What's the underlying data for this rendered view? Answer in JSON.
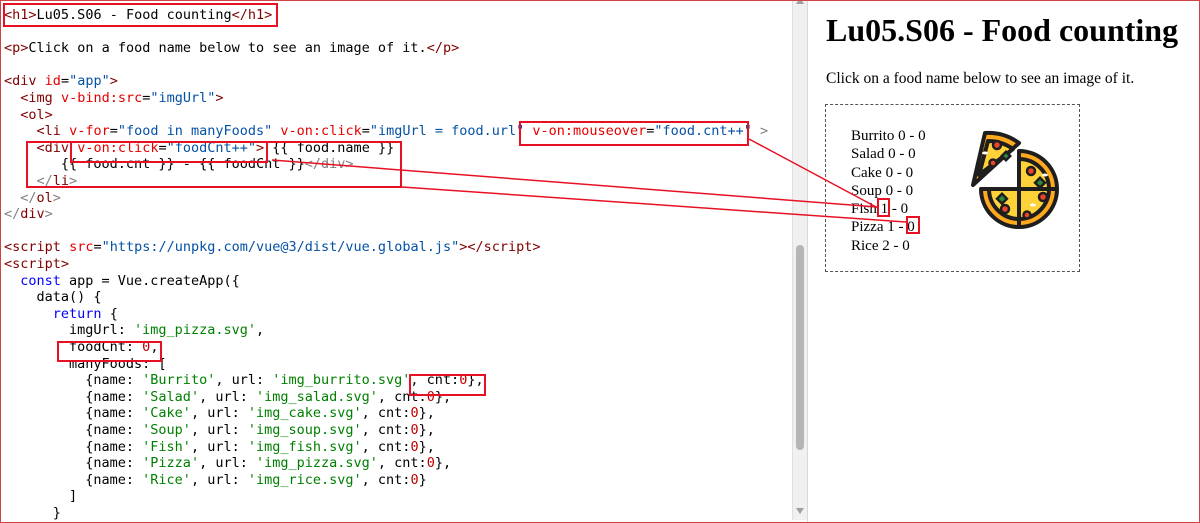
{
  "editor": {
    "lines": [
      {
        "parts": [
          [
            "tag",
            "<"
          ],
          [
            "tagname",
            "h1"
          ],
          [
            "tag",
            ">"
          ],
          [
            "punct",
            "Lu05.S06 - Food counting"
          ],
          [
            "tag",
            "</"
          ],
          [
            "tagname",
            "h1"
          ],
          [
            "tag",
            ">"
          ]
        ]
      },
      {
        "parts": []
      },
      {
        "parts": [
          [
            "tag",
            "<"
          ],
          [
            "tagname",
            "p"
          ],
          [
            "tag",
            ">"
          ],
          [
            "punct",
            "Click on a food name below to see an image of it."
          ],
          [
            "tag",
            "</"
          ],
          [
            "tagname",
            "p"
          ],
          [
            "tag",
            ">"
          ]
        ]
      },
      {
        "parts": []
      },
      {
        "parts": [
          [
            "tag",
            "<"
          ],
          [
            "tagname",
            "div"
          ],
          [
            "punct",
            " "
          ],
          [
            "attr",
            "id"
          ],
          [
            "punct",
            "="
          ],
          [
            "str",
            "\"app\""
          ],
          [
            "tag",
            ">"
          ]
        ]
      },
      {
        "parts": [
          [
            "punct",
            "  "
          ],
          [
            "tag",
            "<"
          ],
          [
            "tagname",
            "img"
          ],
          [
            "punct",
            " "
          ],
          [
            "attr",
            "v-bind:src"
          ],
          [
            "punct",
            "="
          ],
          [
            "str",
            "\"imgUrl\""
          ],
          [
            "tag",
            ">"
          ]
        ]
      },
      {
        "parts": [
          [
            "punct",
            "  "
          ],
          [
            "tag",
            "<"
          ],
          [
            "tagname",
            "ol"
          ],
          [
            "tag",
            ">"
          ]
        ]
      },
      {
        "parts": [
          [
            "punct",
            "    "
          ],
          [
            "tag",
            "<"
          ],
          [
            "tagname",
            "li"
          ],
          [
            "punct",
            " "
          ],
          [
            "attr",
            "v-for"
          ],
          [
            "punct",
            "="
          ],
          [
            "str",
            "\"food in manyFoods\""
          ],
          [
            "punct",
            " "
          ],
          [
            "attr",
            "v-on:click"
          ],
          [
            "punct",
            "="
          ],
          [
            "str",
            "\"imgUrl = food.url\""
          ],
          [
            "punct",
            " "
          ],
          [
            "attr",
            "v-on:mouseover"
          ],
          [
            "punct",
            "="
          ],
          [
            "str",
            "\"food.cnt++\""
          ],
          [
            "punct",
            " "
          ],
          [
            "light",
            ">"
          ]
        ]
      },
      {
        "parts": [
          [
            "punct",
            "    "
          ],
          [
            "tag",
            "<"
          ],
          [
            "tagname",
            "div"
          ],
          [
            "punct",
            " "
          ],
          [
            "attr",
            "v-on:click"
          ],
          [
            "punct",
            "="
          ],
          [
            "str",
            "\"foodCnt++\""
          ],
          [
            "tag",
            ">"
          ],
          [
            "punct",
            " {{ food.name }}"
          ]
        ]
      },
      {
        "parts": [
          [
            "punct",
            "       {{ food.cnt }} - {{ foodCnt }}"
          ],
          [
            "light",
            "</"
          ],
          [
            "light",
            "div"
          ],
          [
            "light",
            ">"
          ]
        ]
      },
      {
        "parts": [
          [
            "punct",
            "    "
          ],
          [
            "light",
            "</"
          ],
          [
            "tagname",
            "li"
          ],
          [
            "light",
            ">"
          ]
        ]
      },
      {
        "parts": [
          [
            "punct",
            "  "
          ],
          [
            "light",
            "</"
          ],
          [
            "tagname",
            "ol"
          ],
          [
            "light",
            ">"
          ]
        ]
      },
      {
        "parts": [
          [
            "light",
            "</"
          ],
          [
            "tagname",
            "div"
          ],
          [
            "light",
            ">"
          ]
        ]
      },
      {
        "parts": []
      },
      {
        "parts": [
          [
            "tag",
            "<"
          ],
          [
            "tagname",
            "script"
          ],
          [
            "punct",
            " "
          ],
          [
            "attr",
            "src"
          ],
          [
            "punct",
            "="
          ],
          [
            "str",
            "\"https://unpkg.com/vue@3/dist/vue.global.js\""
          ],
          [
            "tag",
            "></"
          ],
          [
            "tagname",
            "script"
          ],
          [
            "tag",
            ">"
          ]
        ]
      },
      {
        "parts": [
          [
            "tag",
            "<"
          ],
          [
            "tagname",
            "script"
          ],
          [
            "tag",
            ">"
          ]
        ]
      },
      {
        "parts": [
          [
            "punct",
            "  "
          ],
          [
            "kw",
            "const"
          ],
          [
            "punct",
            " app = Vue.createApp({"
          ]
        ]
      },
      {
        "parts": [
          [
            "punct",
            "    data() {"
          ]
        ]
      },
      {
        "parts": [
          [
            "punct",
            "      "
          ],
          [
            "kw",
            "return"
          ],
          [
            "punct",
            " {"
          ]
        ]
      },
      {
        "parts": [
          [
            "punct",
            "        imgUrl: "
          ],
          [
            "jsstr",
            "'img_pizza.svg'"
          ],
          [
            "punct",
            ","
          ]
        ]
      },
      {
        "parts": [
          [
            "punct",
            "        foodCnt: "
          ],
          [
            "jsnum",
            "0"
          ],
          [
            "punct",
            ","
          ]
        ]
      },
      {
        "parts": [
          [
            "punct",
            "        manyFoods: ["
          ]
        ]
      },
      {
        "parts": [
          [
            "punct",
            "          {name: "
          ],
          [
            "jsstr",
            "'Burrito'"
          ],
          [
            "punct",
            ", url: "
          ],
          [
            "jsstr",
            "'img_burrito.svg'"
          ],
          [
            "punct",
            ", cnt:"
          ],
          [
            "jsnum",
            "0"
          ],
          [
            "punct",
            "},"
          ]
        ]
      },
      {
        "parts": [
          [
            "punct",
            "          {name: "
          ],
          [
            "jsstr",
            "'Salad'"
          ],
          [
            "punct",
            ", url: "
          ],
          [
            "jsstr",
            "'img_salad.svg'"
          ],
          [
            "punct",
            ", cnt:"
          ],
          [
            "jsnum",
            "0"
          ],
          [
            "punct",
            "},"
          ]
        ]
      },
      {
        "parts": [
          [
            "punct",
            "          {name: "
          ],
          [
            "jsstr",
            "'Cake'"
          ],
          [
            "punct",
            ", url: "
          ],
          [
            "jsstr",
            "'img_cake.svg'"
          ],
          [
            "punct",
            ", cnt:"
          ],
          [
            "jsnum",
            "0"
          ],
          [
            "punct",
            "},"
          ]
        ]
      },
      {
        "parts": [
          [
            "punct",
            "          {name: "
          ],
          [
            "jsstr",
            "'Soup'"
          ],
          [
            "punct",
            ", url: "
          ],
          [
            "jsstr",
            "'img_soup.svg'"
          ],
          [
            "punct",
            ", cnt:"
          ],
          [
            "jsnum",
            "0"
          ],
          [
            "punct",
            "},"
          ]
        ]
      },
      {
        "parts": [
          [
            "punct",
            "          {name: "
          ],
          [
            "jsstr",
            "'Fish'"
          ],
          [
            "punct",
            ", url: "
          ],
          [
            "jsstr",
            "'img_fish.svg'"
          ],
          [
            "punct",
            ", cnt:"
          ],
          [
            "jsnum",
            "0"
          ],
          [
            "punct",
            "},"
          ]
        ]
      },
      {
        "parts": [
          [
            "punct",
            "          {name: "
          ],
          [
            "jsstr",
            "'Pizza'"
          ],
          [
            "punct",
            ", url: "
          ],
          [
            "jsstr",
            "'img_pizza.svg'"
          ],
          [
            "punct",
            ", cnt:"
          ],
          [
            "jsnum",
            "0"
          ],
          [
            "punct",
            "},"
          ]
        ]
      },
      {
        "parts": [
          [
            "punct",
            "          {name: "
          ],
          [
            "jsstr",
            "'Rice'"
          ],
          [
            "punct",
            ", url: "
          ],
          [
            "jsstr",
            "'img_rice.svg'"
          ],
          [
            "punct",
            ", cnt:"
          ],
          [
            "jsnum",
            "0"
          ],
          [
            "punct",
            "}"
          ]
        ]
      },
      {
        "parts": [
          [
            "punct",
            "        ]"
          ]
        ]
      },
      {
        "parts": [
          [
            "punct",
            "      }"
          ]
        ]
      }
    ]
  },
  "preview": {
    "title": "Lu05.S06 - Food counting",
    "description": "Click on a food name below to see an image of it.",
    "image_icon": "pizza-image",
    "foods": [
      {
        "name": "Burrito",
        "cnt": "0",
        "foodCnt": "0"
      },
      {
        "name": "Salad",
        "cnt": "0",
        "foodCnt": "0"
      },
      {
        "name": "Cake",
        "cnt": "0",
        "foodCnt": "0"
      },
      {
        "name": "Soup",
        "cnt": "0",
        "foodCnt": "0"
      },
      {
        "name": "Fish",
        "cnt": "1",
        "foodCnt": "0"
      },
      {
        "name": "Pizza",
        "cnt": "1",
        "foodCnt": "0"
      },
      {
        "name": "Rice",
        "cnt": "2",
        "foodCnt": "0"
      }
    ]
  },
  "colors": {
    "annotation": "#e81123",
    "tag": "#800000",
    "attribute": "#e50000",
    "attribute_value": "#0451a5",
    "keyword": "#0000ff",
    "js_string": "#008000",
    "js_number": "#c00000"
  }
}
